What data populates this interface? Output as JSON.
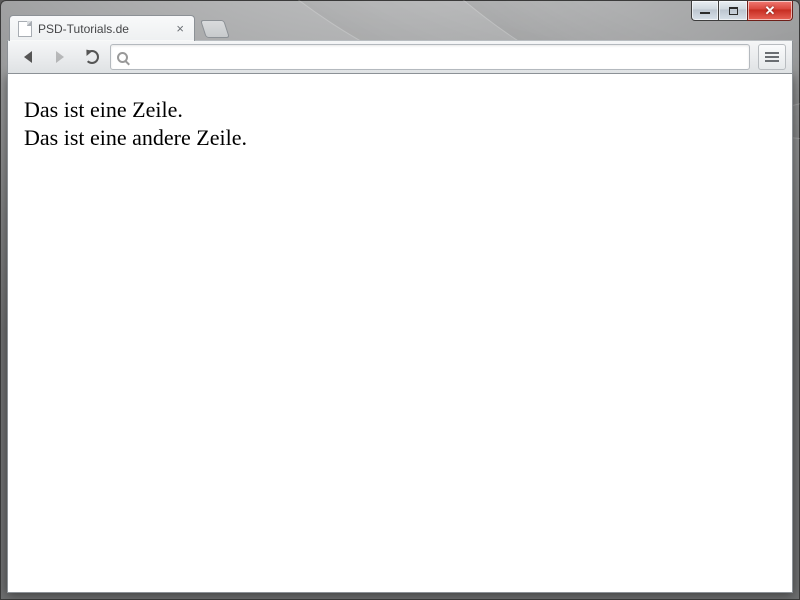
{
  "window": {
    "caption": {
      "min": "Minimieren",
      "max": "Maximieren",
      "close": "Schließen"
    }
  },
  "tab": {
    "title": "PSD-Tutorials.de",
    "close_glyph": "×"
  },
  "toolbar": {
    "back_label": "Zurück",
    "forward_label": "Vorwärts",
    "reload_label": "Neu laden",
    "menu_label": "Menü",
    "omnibox_value": "",
    "omnibox_placeholder": ""
  },
  "page": {
    "line1": "Das ist eine Zeile.",
    "line2": "Das ist eine andere Zeile."
  }
}
